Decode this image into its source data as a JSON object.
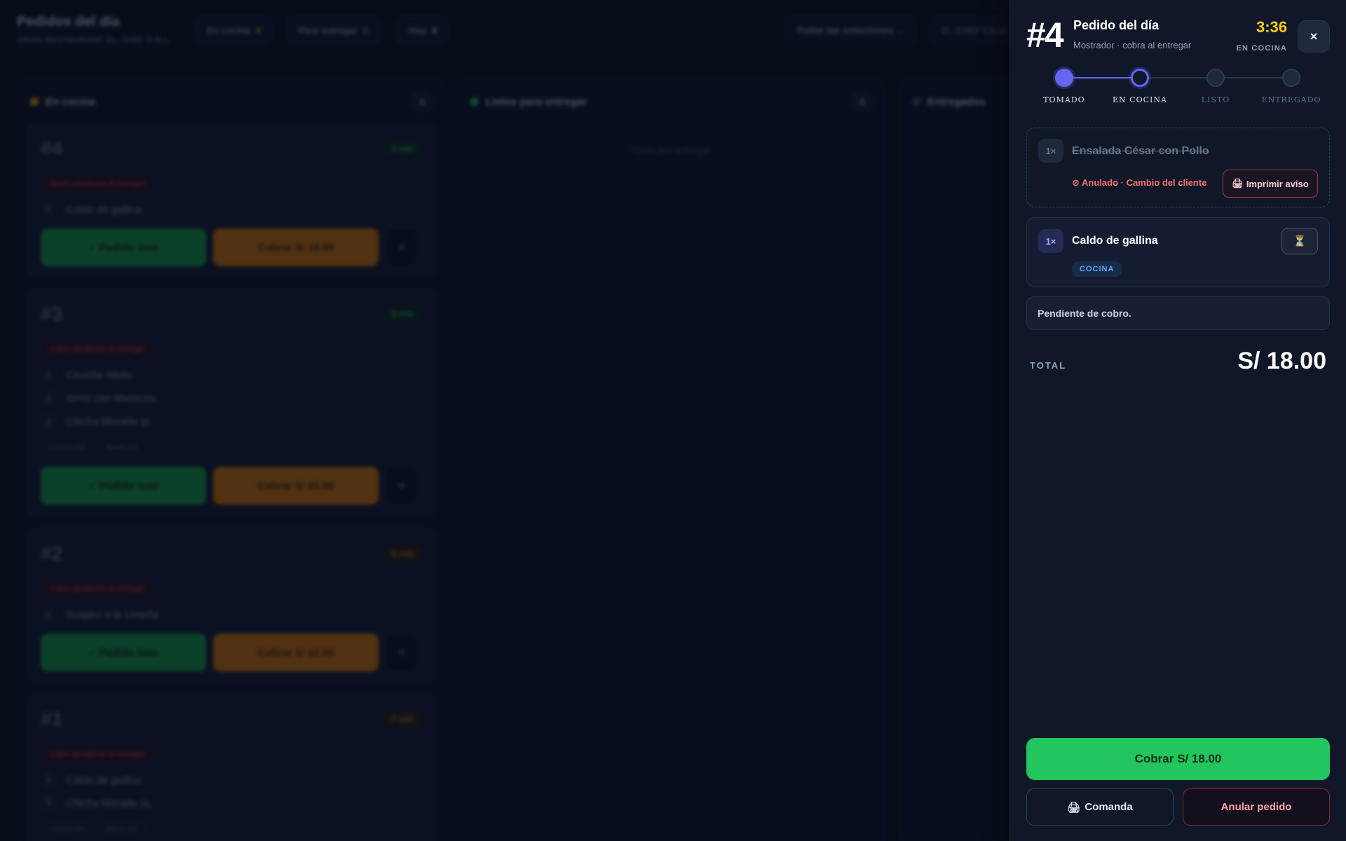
{
  "board": {
    "title": "Pedidos del día",
    "business": "GRAN RESTAURANT EL CHEF S.R.L.",
    "stats": [
      {
        "label": "En cocina",
        "value": "4",
        "color": "#f59e0b"
      },
      {
        "label": "Para entregar",
        "value": "0",
        "color": "#22c55e"
      },
      {
        "label": "Hoy",
        "value": "4",
        "color": "#cbd5e1"
      }
    ],
    "station_filter": "Todas las estaciones",
    "user": "EL CHEF CAJA",
    "columns": [
      {
        "title": "En cocina",
        "count": "4",
        "color": "#f59e0b"
      },
      {
        "title": "Listos para entregar",
        "count": "0",
        "color": "#22c55e",
        "empty": "Nada por entregar"
      },
      {
        "title": "Entregados",
        "count": "",
        "color": "#64748b"
      }
    ],
    "ready_label": "✓ Pedido listo",
    "more_label": "▾",
    "pending_label": "Cobro pendiente al entregar",
    "orders": [
      {
        "number": "#4",
        "mins": "3 min",
        "items": [
          {
            "qty": "1",
            "name": "Caldo de gallina"
          }
        ],
        "tags": [],
        "charge": "Cobrar S/ 18.00"
      },
      {
        "number": "#3",
        "mins": "3 min",
        "items": [
          {
            "qty": "1",
            "name": "Ceviche Mixto"
          },
          {
            "qty": "1",
            "name": "Arroz con Mariscos"
          },
          {
            "qty": "1",
            "name": "Chicha Morada 1L"
          }
        ],
        "tags": [
          "Cocina 0/2",
          "Barra 0/1"
        ],
        "charge": "Cobrar S/ 65.00"
      },
      {
        "number": "#2",
        "mins": "6 min",
        "items": [
          {
            "qty": "1",
            "name": "Suspiro a la Limeña"
          }
        ],
        "tags": [],
        "charge": "Cobrar S/ 12.00"
      },
      {
        "number": "#1",
        "mins": "7 min",
        "items": [
          {
            "qty": "1",
            "name": "Caldo de gallina"
          },
          {
            "qty": "1",
            "name": "Chicha Morada 1L"
          }
        ],
        "tags": [
          "Cocina 0/1",
          "Barra 0/1"
        ],
        "charge": ""
      }
    ]
  },
  "panel": {
    "order_number": "#4",
    "title": "Pedido del día",
    "subtitle": "Mostrador · cobra al entregar",
    "timer": "3:36",
    "state": "EN COCINA",
    "close_icon": "×",
    "steps": [
      {
        "label": "TOMADO",
        "status": "done"
      },
      {
        "label": "EN COCINA",
        "status": "current"
      },
      {
        "label": "LISTO",
        "status": "todo"
      },
      {
        "label": "ENTREGADO",
        "status": "todo"
      }
    ],
    "lines": [
      {
        "qty": "1×",
        "name": "Ensalada César con Pollo",
        "voided": true,
        "void_note": "⊘ Anulado · Cambio del cliente",
        "print_icon": "🖨",
        "print_label": "Imprimir aviso"
      },
      {
        "qty": "1×",
        "name": "Caldo de gallina",
        "voided": false,
        "station": "COCINA",
        "status_icon": "⏳"
      }
    ],
    "note": "Pendiente de cobro.",
    "total_label": "TOTAL",
    "total_value": "S/ 18.00",
    "pay_button": "Cobrar S/ 18.00",
    "comanda_icon": "🖨",
    "comanda_button": "Comanda",
    "cancel_button": "Anular pedido"
  }
}
